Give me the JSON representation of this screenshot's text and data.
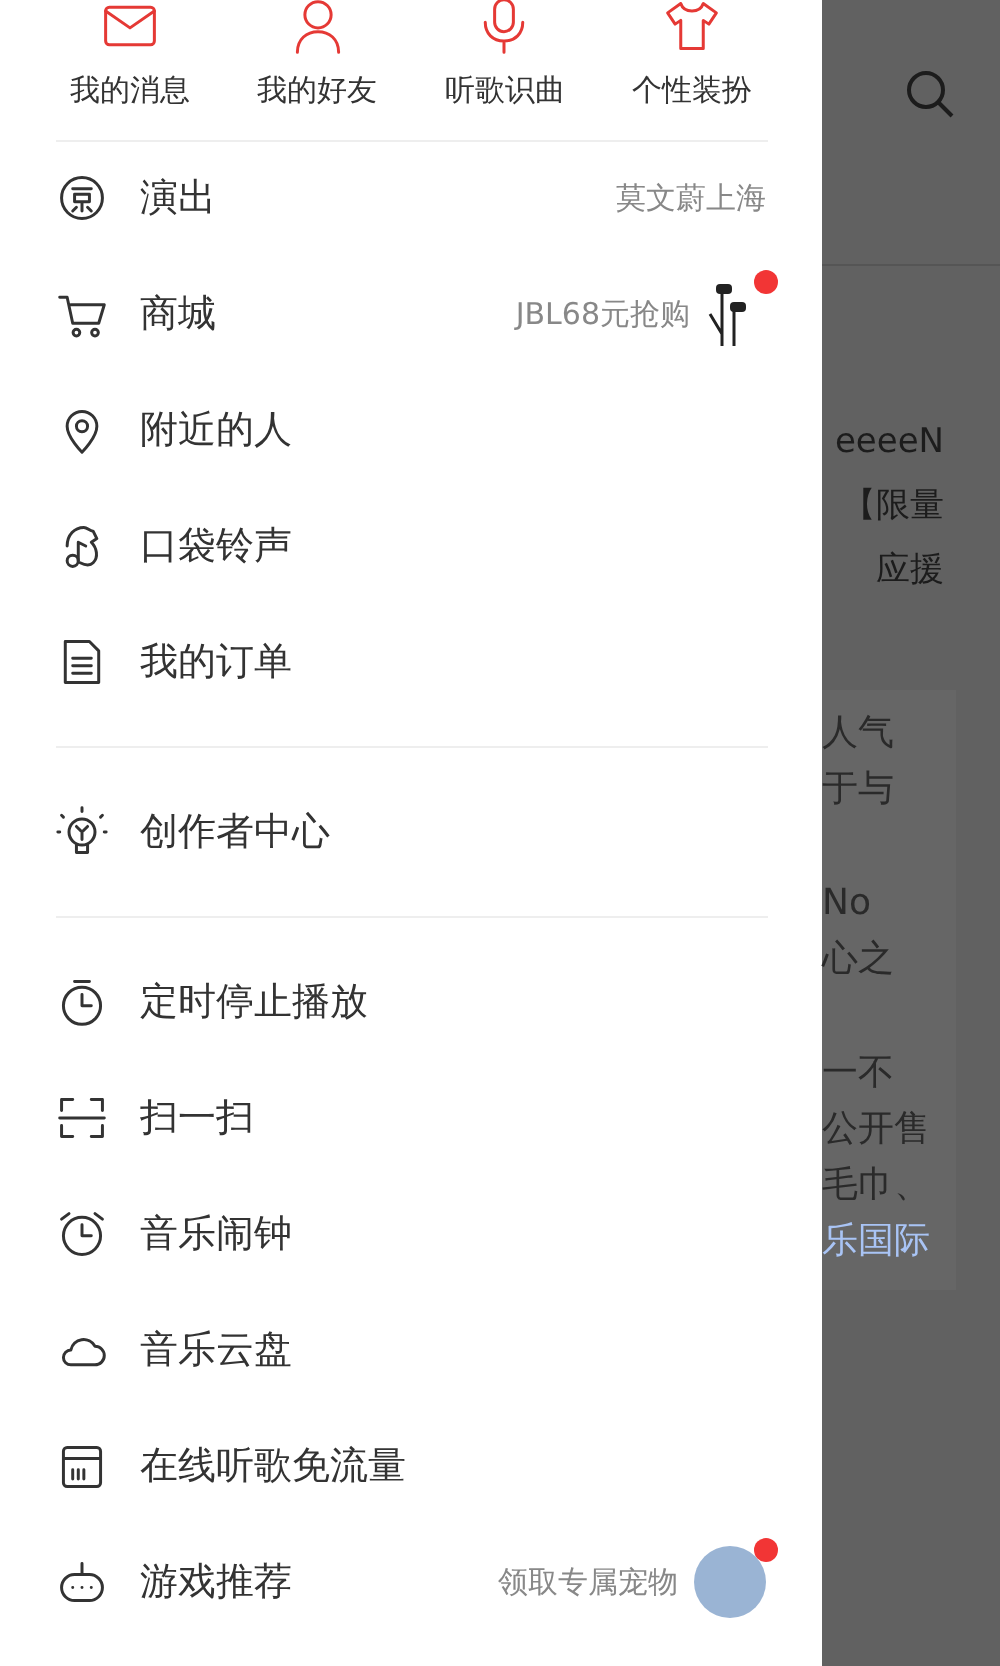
{
  "quick_actions": [
    {
      "label": "我的消息",
      "kind": "mail"
    },
    {
      "label": "我的好友",
      "kind": "person"
    },
    {
      "label": "听歌识曲",
      "kind": "mic"
    },
    {
      "label": "个性装扮",
      "kind": "shirt"
    }
  ],
  "menu_groups": [
    [
      {
        "label": "演出",
        "kind": "ticket",
        "detail": "莫文蔚上海",
        "dot": false
      },
      {
        "label": "商城",
        "kind": "cart",
        "detail": "JBL68元抢购",
        "thumbnail": {
          "kind": "earphones"
        },
        "dot": true
      },
      {
        "label": "附近的人",
        "kind": "pin",
        "dot": false
      },
      {
        "label": "口袋铃声",
        "kind": "ringtone",
        "dot": false
      },
      {
        "label": "我的订单",
        "kind": "order",
        "dot": false
      }
    ],
    [
      {
        "label": "创作者中心",
        "kind": "bulb",
        "dot": false
      }
    ],
    [
      {
        "label": "定时停止播放",
        "kind": "timer",
        "dot": false
      },
      {
        "label": "扫一扫",
        "kind": "scan",
        "dot": false
      },
      {
        "label": "音乐闹钟",
        "kind": "alarm",
        "dot": false
      },
      {
        "label": "音乐云盘",
        "kind": "cloud",
        "dot": false
      },
      {
        "label": "在线听歌免流量",
        "kind": "sim",
        "dot": false
      },
      {
        "label": "游戏推荐",
        "kind": "game",
        "detail": "领取专属宠物",
        "thumbnail": {
          "kind": "avatar"
        },
        "dot": true
      }
    ]
  ],
  "background_page": {
    "header_lines": [
      "eeeeN",
      "【限量",
      "应援"
    ],
    "card_paragraphs": [
      [
        {
          "text": "人气",
          "kind": "plain"
        },
        {
          "text": "于与",
          "kind": "plain"
        }
      ],
      [
        {
          "text": "No",
          "kind": "plain"
        },
        {
          "text": "心之",
          "kind": "plain"
        }
      ],
      [
        {
          "text": "一不",
          "kind": "plain"
        },
        {
          "text": "公开售",
          "kind": "plain"
        },
        {
          "text": "毛巾、",
          "kind": "plain"
        },
        {
          "text": "乐国际",
          "kind": "link"
        }
      ]
    ]
  }
}
